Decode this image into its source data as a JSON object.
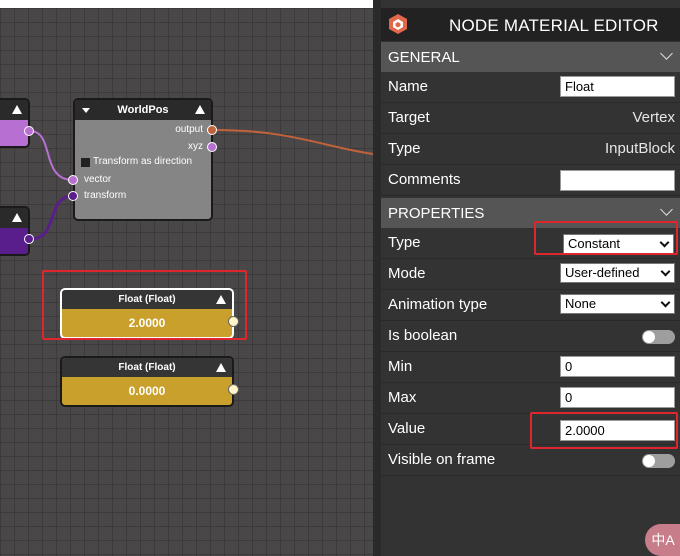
{
  "canvas": {
    "worldpos_node": {
      "title": "WorldPos",
      "outputs": [
        "output",
        "xyz"
      ],
      "checkbox_label": "Transform as direction",
      "inputs": [
        "vector",
        "transform"
      ]
    },
    "float_nodes": [
      {
        "title": "Float (Float)",
        "value": "2.0000"
      },
      {
        "title": "Float (Float)",
        "value": "0.0000"
      }
    ]
  },
  "panel": {
    "title": "NODE MATERIAL EDITOR",
    "general": {
      "header": "GENERAL",
      "name_label": "Name",
      "name_value": "Float",
      "target_label": "Target",
      "target_value": "Vertex",
      "type_label": "Type",
      "type_value": "InputBlock",
      "comments_label": "Comments",
      "comments_value": ""
    },
    "properties": {
      "header": "PROPERTIES",
      "type_label": "Type",
      "type_value": "Constant",
      "mode_label": "Mode",
      "mode_value": "User-defined",
      "animation_label": "Animation type",
      "animation_value": "None",
      "is_boolean_label": "Is boolean",
      "is_boolean_on": false,
      "min_label": "Min",
      "min_value": "0",
      "max_label": "Max",
      "max_value": "0",
      "value_label": "Value",
      "value_value": "2.0000",
      "visible_label": "Visible on frame",
      "visible_on": false
    },
    "translate_glyph": "中A"
  },
  "colors": {
    "float_body": "#c9a02c",
    "vector_port": "#b86fd2",
    "matrix_port": "#5a1e8c",
    "link_output": "#c0633a",
    "highlight": "#e0262d"
  }
}
